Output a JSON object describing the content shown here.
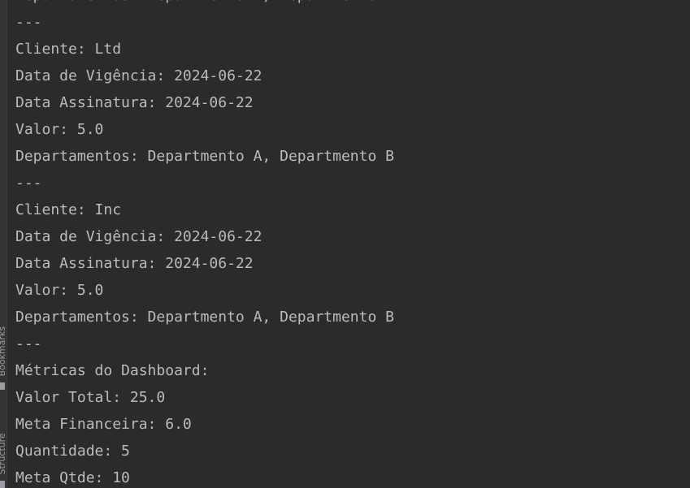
{
  "sidebar": {
    "bookmarks_label": "Bookmarks",
    "structure_label": "Structure"
  },
  "console": {
    "lines": [
      "Departamentos: Departmento A, Departmento B",
      "---",
      "Cliente: Ltd",
      "Data de Vigência: 2024-06-22",
      "Data Assinatura: 2024-06-22",
      "Valor: 5.0",
      "Departamentos: Departmento A, Departmento B",
      "---",
      "Cliente: Inc",
      "Data de Vigência: 2024-06-22",
      "Data Assinatura: 2024-06-22",
      "Valor: 5.0",
      "Departamentos: Departmento A, Departmento B",
      "---",
      "Métricas do Dashboard:",
      "Valor Total: 25.0",
      "Meta Financeira: 6.0",
      "Quantidade: 5",
      "Meta Qtde: 10"
    ]
  },
  "colors": {
    "background": "#2b2b2b",
    "text": "#bbbbbb",
    "sidebar": "#313335"
  }
}
